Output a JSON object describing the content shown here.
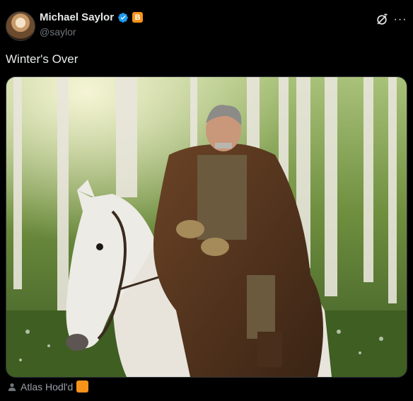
{
  "author": {
    "display_name": "Michael Saylor",
    "handle": "@saylor",
    "badge_letter": "B",
    "verified_color": "#1d9bf0",
    "badge_color": "#f7931a"
  },
  "icons": {
    "grok": "grok-icon",
    "more": "more-icon",
    "person": "person-icon"
  },
  "tweet": {
    "text": "Winter's Over"
  },
  "media": {
    "description_icon": "photo"
  },
  "footer": {
    "label": "Atlas Hodl'd"
  }
}
